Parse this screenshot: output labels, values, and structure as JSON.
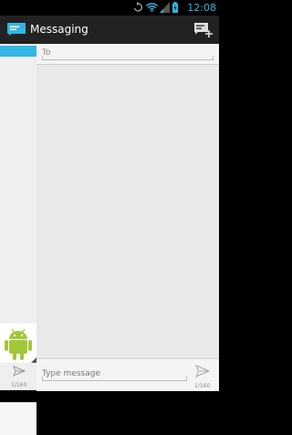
{
  "status_bar": {
    "time": "12:08",
    "time_color": "#33b5e5",
    "icons": [
      "sync-icon",
      "wifi-icon",
      "signal-icon",
      "battery-icon"
    ]
  },
  "action_bar": {
    "title": "Messaging",
    "app_icon": "messaging-icon",
    "compose_icon": "new-message-icon"
  },
  "recipient": {
    "placeholder": "To",
    "value": ""
  },
  "compose": {
    "placeholder": "Type message",
    "value": "",
    "char_counter": "1/160",
    "send_icon": "send-icon"
  },
  "previous_panel": {
    "char_counter": "1/160",
    "avatar_icon": "android-avatar-icon",
    "send_icon": "send-icon"
  },
  "colors": {
    "accent": "#33b5e5",
    "action_bar": "#222222",
    "android_green": "#a4c639"
  }
}
